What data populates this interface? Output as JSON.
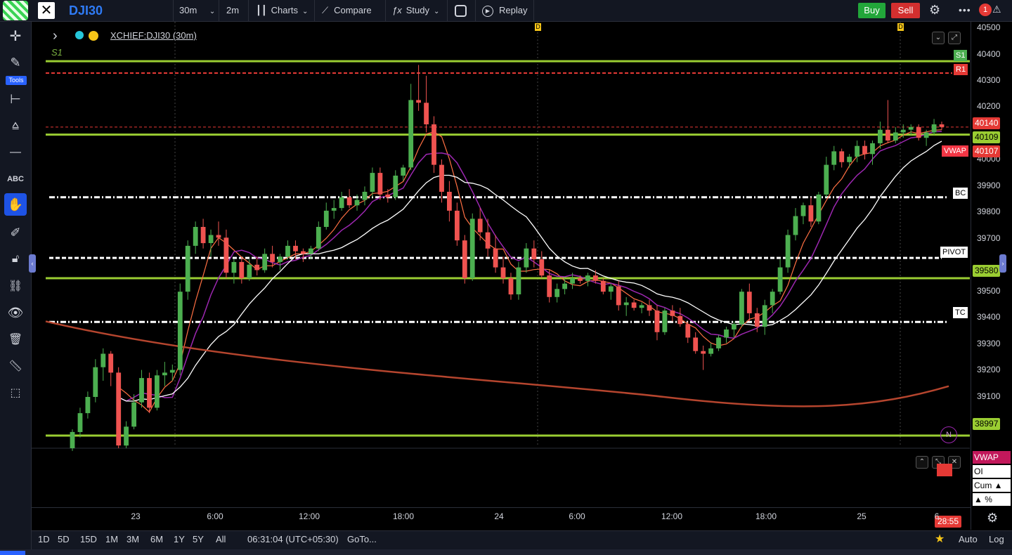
{
  "toolbar": {
    "symbol": "DJI30",
    "interval": "30m",
    "interval2": "2m",
    "charts_label": "Charts",
    "compare_label": "Compare",
    "study_label": "Study",
    "replay_label": "Replay",
    "buy_label": "Buy",
    "sell_label": "Sell",
    "notif_count": "1"
  },
  "left_tools": {
    "tools_label": "Tools"
  },
  "legend": {
    "title": "XCHIEF:DJI30 (30m)"
  },
  "markers": {
    "d_marker": "D"
  },
  "levels": {
    "s1_left": "S1",
    "s1": "S1",
    "r1": "R1",
    "bc": "BC",
    "pivot": "PIVOT",
    "tc": "TC",
    "vwap": "VWAP"
  },
  "price_axis": {
    "ticks": [
      "40500",
      "40400",
      "40300",
      "40200",
      "40000",
      "39900",
      "39800",
      "39700",
      "39500",
      "39400",
      "39300",
      "39200",
      "39100"
    ],
    "badge_40140": "40140",
    "badge_40109": "40109",
    "badge_40107": "40107",
    "badge_39580": "39580",
    "badge_38997": "38997",
    "countdown": "28:55",
    "colors": {
      "green_level": "#9acd32",
      "red_level": "#e53935",
      "vwap": "#f23645"
    }
  },
  "indicator_panel": {
    "vwap_label": "VWAP",
    "oi_label": "OI DChng",
    "cum_label": "Cum ▲",
    "pct_label": "▲ %",
    "n_badge": "N"
  },
  "time_axis": {
    "labels": [
      "23",
      "6:00",
      "12:00",
      "18:00",
      "24",
      "6:00",
      "12:00",
      "18:00",
      "25",
      "6"
    ]
  },
  "bottom_bar": {
    "ranges": [
      "1D",
      "5D",
      "15D",
      "1M",
      "3M",
      "6M",
      "1Y",
      "5Y",
      "All"
    ],
    "clock": "06:31:04 (UTC+05:30)",
    "goto_label": "GoTo...",
    "auto_label": "Auto",
    "log_label": "Log"
  },
  "chart_data": {
    "type": "candlestick",
    "interval": "30m",
    "y_range": [
      38950,
      40530
    ],
    "levels": {
      "S1": 40384,
      "R1": 40340,
      "upper_green": 40112,
      "BC": 39880,
      "PIVOT": 39655,
      "green_mid": 39580,
      "TC": 39418,
      "lower_green": 38997
    },
    "candles": [
      [
        38950,
        39020,
        38940,
        39010
      ],
      [
        39010,
        39100,
        38990,
        39080
      ],
      [
        39080,
        39160,
        39060,
        39140
      ],
      [
        39140,
        39280,
        39120,
        39250
      ],
      [
        39250,
        39320,
        39200,
        39300
      ],
      [
        39300,
        39310,
        39180,
        39230
      ],
      [
        39230,
        39250,
        38950,
        38960
      ],
      [
        38960,
        39050,
        38950,
        39030
      ],
      [
        39030,
        39150,
        39020,
        39120
      ],
      [
        39120,
        39240,
        39100,
        39210
      ],
      [
        39210,
        39230,
        39080,
        39100
      ],
      [
        39100,
        39240,
        39090,
        39220
      ],
      [
        39220,
        39270,
        39180,
        39230
      ],
      [
        39230,
        39260,
        39200,
        39240
      ],
      [
        39240,
        39560,
        39220,
        39530
      ],
      [
        39530,
        39720,
        39500,
        39700
      ],
      [
        39700,
        39790,
        39670,
        39770
      ],
      [
        39770,
        39800,
        39690,
        39710
      ],
      [
        39710,
        39760,
        39660,
        39740
      ],
      [
        39740,
        39790,
        39700,
        39730
      ],
      [
        39730,
        39760,
        39580,
        39600
      ],
      [
        39600,
        39650,
        39560,
        39640
      ],
      [
        39640,
        39660,
        39560,
        39580
      ],
      [
        39580,
        39650,
        39570,
        39630
      ],
      [
        39630,
        39660,
        39590,
        39610
      ],
      [
        39610,
        39690,
        39600,
        39670
      ],
      [
        39670,
        39700,
        39620,
        39640
      ],
      [
        39640,
        39670,
        39610,
        39660
      ],
      [
        39660,
        39720,
        39650,
        39700
      ],
      [
        39700,
        39720,
        39650,
        39680
      ],
      [
        39680,
        39690,
        39640,
        39670
      ],
      [
        39670,
        39700,
        39650,
        39690
      ],
      [
        39690,
        39790,
        39680,
        39770
      ],
      [
        39770,
        39860,
        39760,
        39830
      ],
      [
        39830,
        39870,
        39800,
        39840
      ],
      [
        39840,
        39900,
        39830,
        39880
      ],
      [
        39880,
        39910,
        39840,
        39850
      ],
      [
        39850,
        39890,
        39830,
        39870
      ],
      [
        39870,
        39920,
        39850,
        39900
      ],
      [
        39900,
        39990,
        39880,
        39970
      ],
      [
        39970,
        39990,
        39870,
        39890
      ],
      [
        39890,
        39910,
        39860,
        39880
      ],
      [
        39880,
        39980,
        39870,
        39960
      ],
      [
        39960,
        40000,
        39940,
        39990
      ],
      [
        39990,
        40300,
        39980,
        40240
      ],
      [
        40240,
        40370,
        40200,
        40230
      ],
      [
        40230,
        40330,
        40120,
        40150
      ],
      [
        40150,
        40180,
        39970,
        40000
      ],
      [
        40000,
        40020,
        39860,
        39900
      ],
      [
        39900,
        39940,
        39790,
        39830
      ],
      [
        39830,
        39860,
        39700,
        39720
      ],
      [
        39720,
        39740,
        39560,
        39580
      ],
      [
        39580,
        39820,
        39570,
        39800
      ],
      [
        39800,
        39840,
        39720,
        39750
      ],
      [
        39750,
        39800,
        39660,
        39690
      ],
      [
        39690,
        39740,
        39600,
        39620
      ],
      [
        39620,
        39660,
        39560,
        39580
      ],
      [
        39580,
        39600,
        39500,
        39520
      ],
      [
        39520,
        39640,
        39500,
        39620
      ],
      [
        39620,
        39710,
        39600,
        39690
      ],
      [
        39690,
        39720,
        39620,
        39650
      ],
      [
        39650,
        39680,
        39580,
        39590
      ],
      [
        39590,
        39610,
        39490,
        39510
      ],
      [
        39510,
        39560,
        39490,
        39540
      ],
      [
        39540,
        39580,
        39520,
        39560
      ],
      [
        39560,
        39600,
        39540,
        39580
      ],
      [
        39580,
        39590,
        39560,
        39570
      ],
      [
        39570,
        39600,
        39550,
        39590
      ],
      [
        39590,
        39610,
        39560,
        39570
      ],
      [
        39570,
        39580,
        39520,
        39530
      ],
      [
        39530,
        39560,
        39500,
        39550
      ],
      [
        39550,
        39570,
        39460,
        39480
      ],
      [
        39480,
        39510,
        39440,
        39490
      ],
      [
        39490,
        39500,
        39460,
        39470
      ],
      [
        39470,
        39490,
        39450,
        39480
      ],
      [
        39480,
        39500,
        39440,
        39460
      ],
      [
        39460,
        39480,
        39350,
        39380
      ],
      [
        39380,
        39470,
        39370,
        39460
      ],
      [
        39460,
        39480,
        39420,
        39440
      ],
      [
        39440,
        39470,
        39400,
        39410
      ],
      [
        39410,
        39420,
        39340,
        39360
      ],
      [
        39360,
        39380,
        39300,
        39310
      ],
      [
        39310,
        39330,
        39240,
        39300
      ],
      [
        39300,
        39340,
        39290,
        39320
      ],
      [
        39320,
        39370,
        39310,
        39360
      ],
      [
        39360,
        39400,
        39340,
        39390
      ],
      [
        39390,
        39420,
        39360,
        39410
      ],
      [
        39410,
        39540,
        39400,
        39530
      ],
      [
        39530,
        39560,
        39420,
        39450
      ],
      [
        39450,
        39470,
        39380,
        39400
      ],
      [
        39400,
        39500,
        39370,
        39480
      ],
      [
        39480,
        39540,
        39450,
        39530
      ],
      [
        39530,
        39650,
        39520,
        39620
      ],
      [
        39620,
        39760,
        39600,
        39740
      ],
      [
        39740,
        39840,
        39720,
        39810
      ],
      [
        39810,
        39860,
        39780,
        39850
      ],
      [
        39850,
        39880,
        39770,
        39790
      ],
      [
        39790,
        39900,
        39780,
        39890
      ],
      [
        39890,
        40030,
        39880,
        40000
      ],
      [
        40000,
        40070,
        39980,
        40050
      ],
      [
        40050,
        40060,
        39990,
        40010
      ],
      [
        40010,
        40040,
        39990,
        40030
      ],
      [
        40030,
        40090,
        40010,
        40070
      ],
      [
        40070,
        40090,
        40020,
        40040
      ],
      [
        40040,
        40090,
        40000,
        40080
      ],
      [
        40080,
        40160,
        40060,
        40130
      ],
      [
        40130,
        40240,
        40080,
        40090
      ],
      [
        40090,
        40140,
        40080,
        40120
      ],
      [
        40120,
        40150,
        40100,
        40130
      ],
      [
        40130,
        40150,
        40110,
        40140
      ],
      [
        40140,
        40150,
        40090,
        40100
      ],
      [
        40100,
        40130,
        40070,
        40120
      ],
      [
        40120,
        40170,
        40110,
        40150
      ],
      [
        40150,
        40160,
        40130,
        40140
      ]
    ]
  }
}
